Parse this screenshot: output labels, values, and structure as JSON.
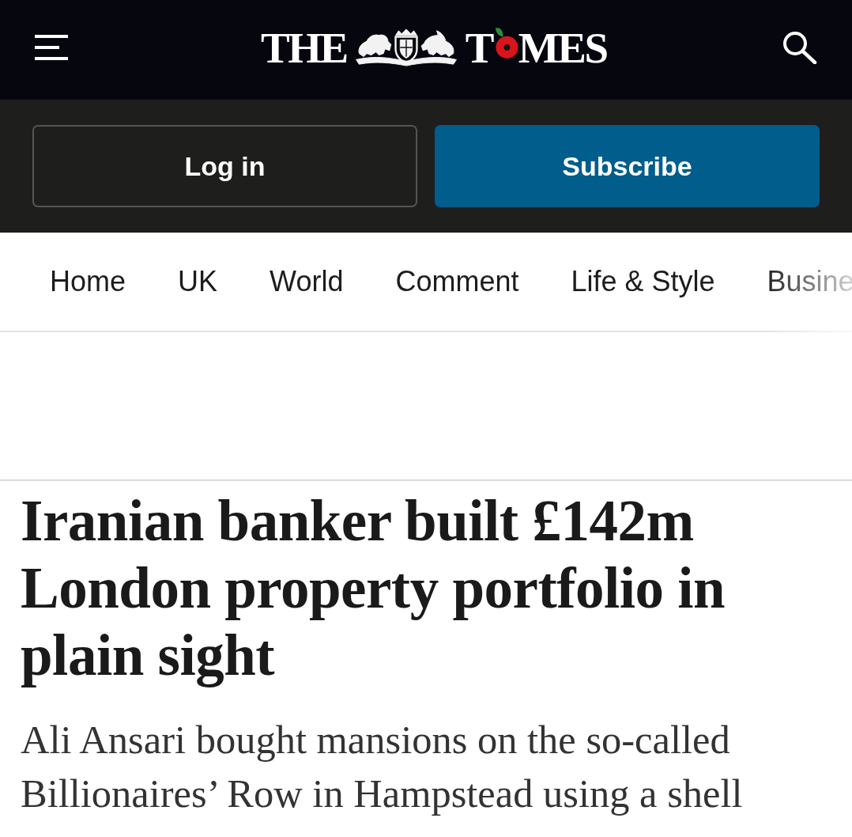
{
  "header": {
    "logo": {
      "left": "THE",
      "right_start": "T",
      "right_end": "MES"
    }
  },
  "account": {
    "buttons": [
      {
        "label": "Log in",
        "kind": "outline"
      },
      {
        "label": "Subscribe",
        "kind": "primary"
      }
    ]
  },
  "nav": {
    "items": [
      {
        "label": "Home"
      },
      {
        "label": "UK"
      },
      {
        "label": "World"
      },
      {
        "label": "Comment"
      },
      {
        "label": "Life & Style"
      },
      {
        "label": "Busine"
      }
    ]
  },
  "article": {
    "headline": "Iranian banker built £142m London property portfolio in plain sight",
    "standfirst": "Ali Ansari bought mansions on the so-called Billionaires’ Row in Hampstead using a shell"
  }
}
